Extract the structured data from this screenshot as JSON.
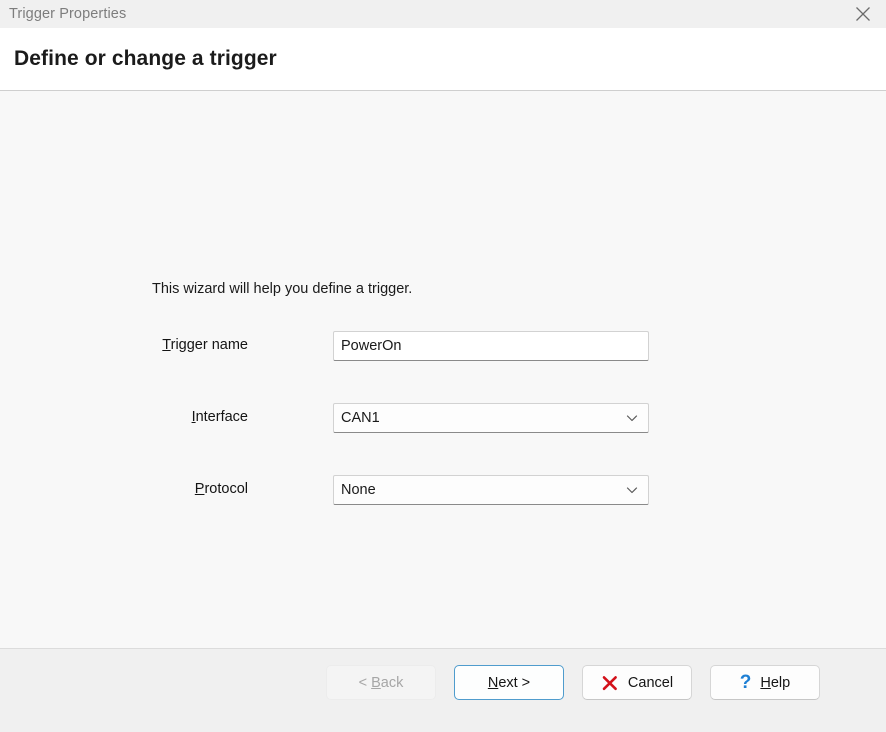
{
  "window": {
    "title": "Trigger Properties",
    "close_icon": "close-icon"
  },
  "header": {
    "title": "Define or change a trigger"
  },
  "main": {
    "intro_text": "This wizard will help you define a trigger.",
    "fields": [
      {
        "label_before": "",
        "label_accesskey": "T",
        "label_after": "rigger name",
        "type": "text",
        "value": "PowerOn",
        "placeholder": ""
      },
      {
        "label_before": "",
        "label_accesskey": "I",
        "label_after": "nterface",
        "type": "combo",
        "value": "CAN1",
        "arrow_icon": "chevron-down-icon"
      },
      {
        "label_before": "",
        "label_accesskey": "P",
        "label_after": "rotocol",
        "type": "combo",
        "value": "None",
        "arrow_icon": "chevron-down-icon"
      }
    ]
  },
  "footer": {
    "buttons": [
      {
        "name": "back-button",
        "text_before": "< ",
        "accesskey": "B",
        "text_after": "ack",
        "state": "disabled",
        "icon": ""
      },
      {
        "name": "next-button",
        "text_before": "",
        "accesskey": "N",
        "text_after": "ext >",
        "state": "default",
        "icon": ""
      },
      {
        "name": "cancel-button",
        "text_before": "",
        "accesskey": "",
        "text_after": "Cancel",
        "state": "normal",
        "icon": "red-x-icon"
      },
      {
        "name": "help-button",
        "text_before": "",
        "accesskey": "H",
        "text_after": "elp",
        "state": "normal",
        "icon": "blue-question-icon"
      }
    ]
  },
  "colors": {
    "titlebar_bg": "#f0f0f0",
    "header_bg": "#ffffff",
    "content_bg": "#f8f8f8",
    "footer_bg": "#f0f0f0",
    "default_button_border": "#4f9ccd",
    "cancel_icon": "#d3111a",
    "help_icon": "#1d7fd4",
    "title_text": "#7d7d7d"
  }
}
